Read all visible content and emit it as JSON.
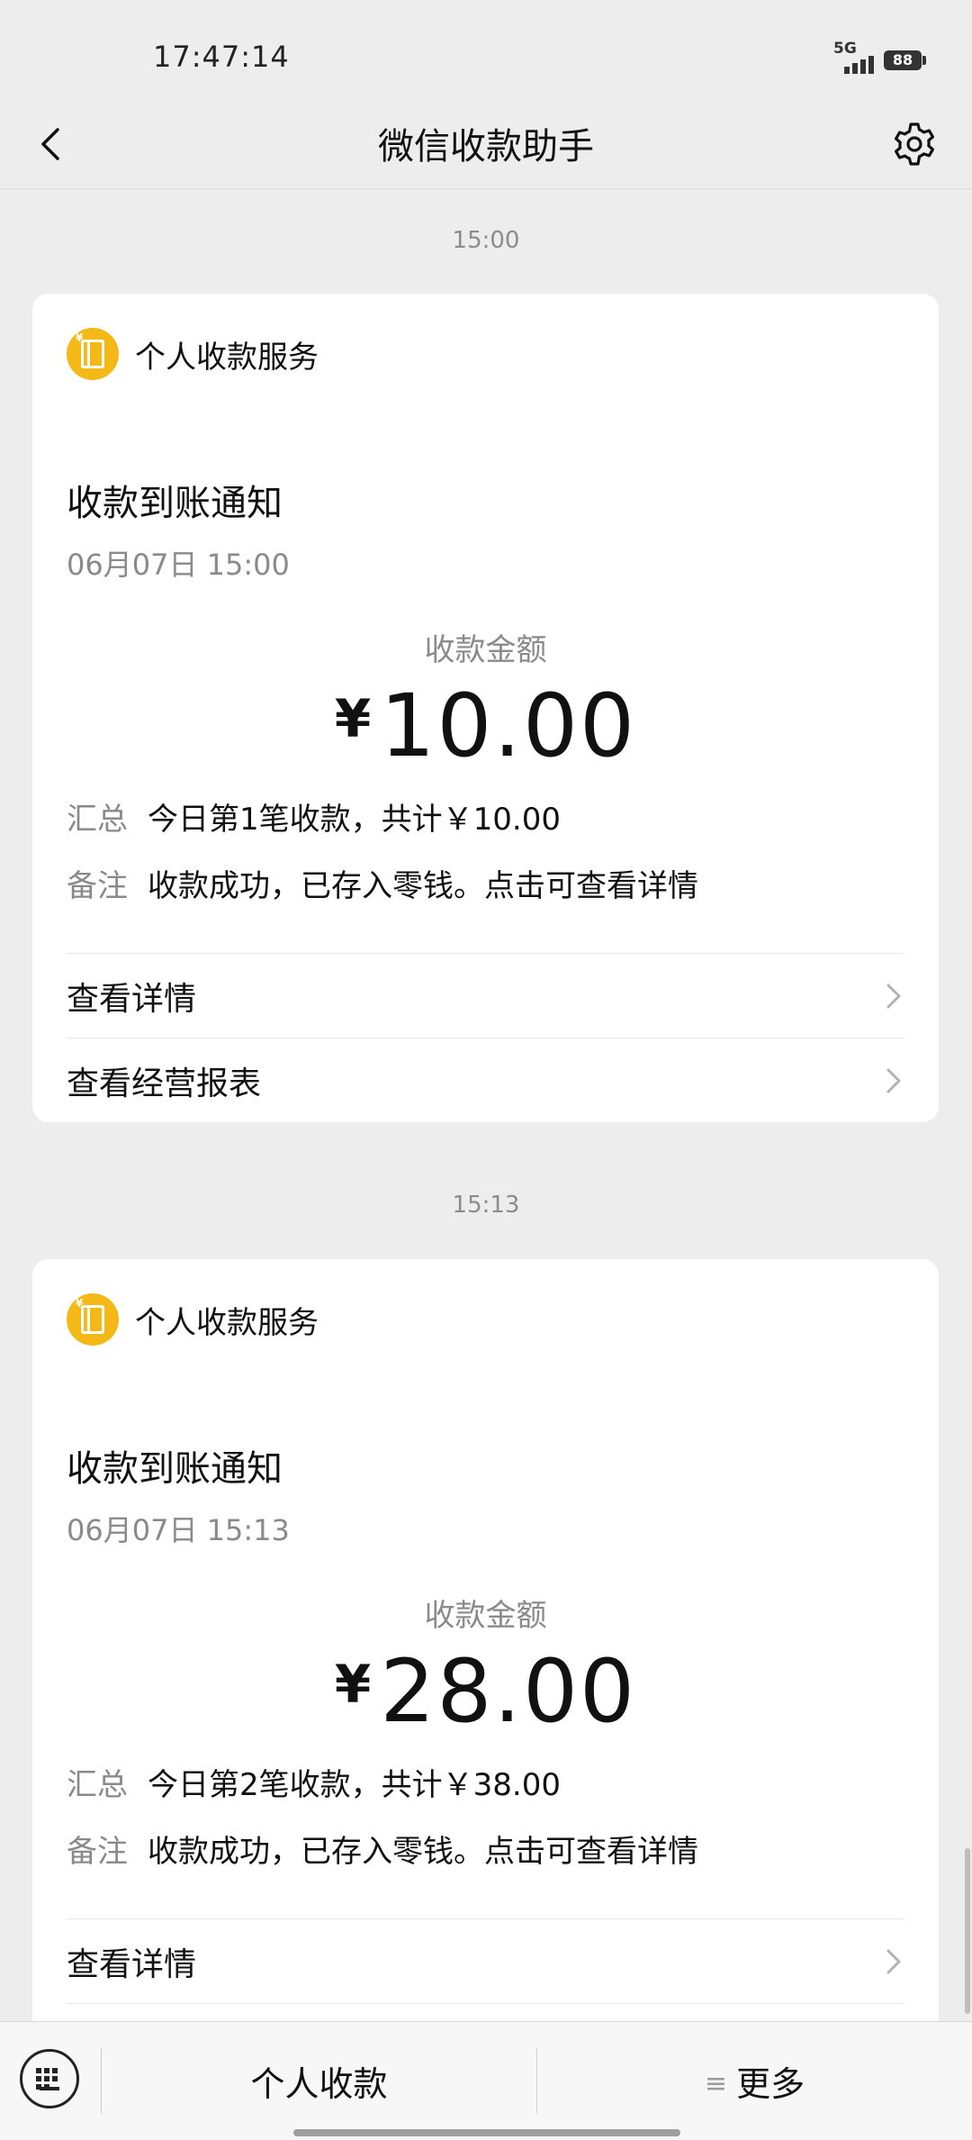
{
  "status": {
    "time": "17:47:14",
    "network": "5G",
    "battery": "88"
  },
  "nav": {
    "title": "微信收款助手"
  },
  "messages": [
    {
      "time": "15:00",
      "service": "个人收款服务",
      "title": "收款到账通知",
      "date": "06月07日 15:00",
      "amount_label": "收款金额",
      "currency": "¥",
      "amount": "10.00",
      "summary_label": "汇总",
      "summary": "今日第1笔收款，共计￥10.00",
      "remark_label": "备注",
      "remark": "收款成功，已存入零钱。点击可查看详情",
      "link_details": "查看详情",
      "link_report": "查看经营报表"
    },
    {
      "time": "15:13",
      "service": "个人收款服务",
      "title": "收款到账通知",
      "date": "06月07日 15:13",
      "amount_label": "收款金额",
      "currency": "¥",
      "amount": "28.00",
      "summary_label": "汇总",
      "summary": "今日第2笔收款，共计￥38.00",
      "remark_label": "备注",
      "remark": "收款成功，已存入零钱。点击可查看详情",
      "link_details": "查看详情"
    }
  ],
  "bottom": {
    "personal": "个人收款",
    "more_icon": "≡",
    "more": "更多"
  },
  "colors": {
    "background": "#ededed",
    "brand": "#f4b817"
  }
}
